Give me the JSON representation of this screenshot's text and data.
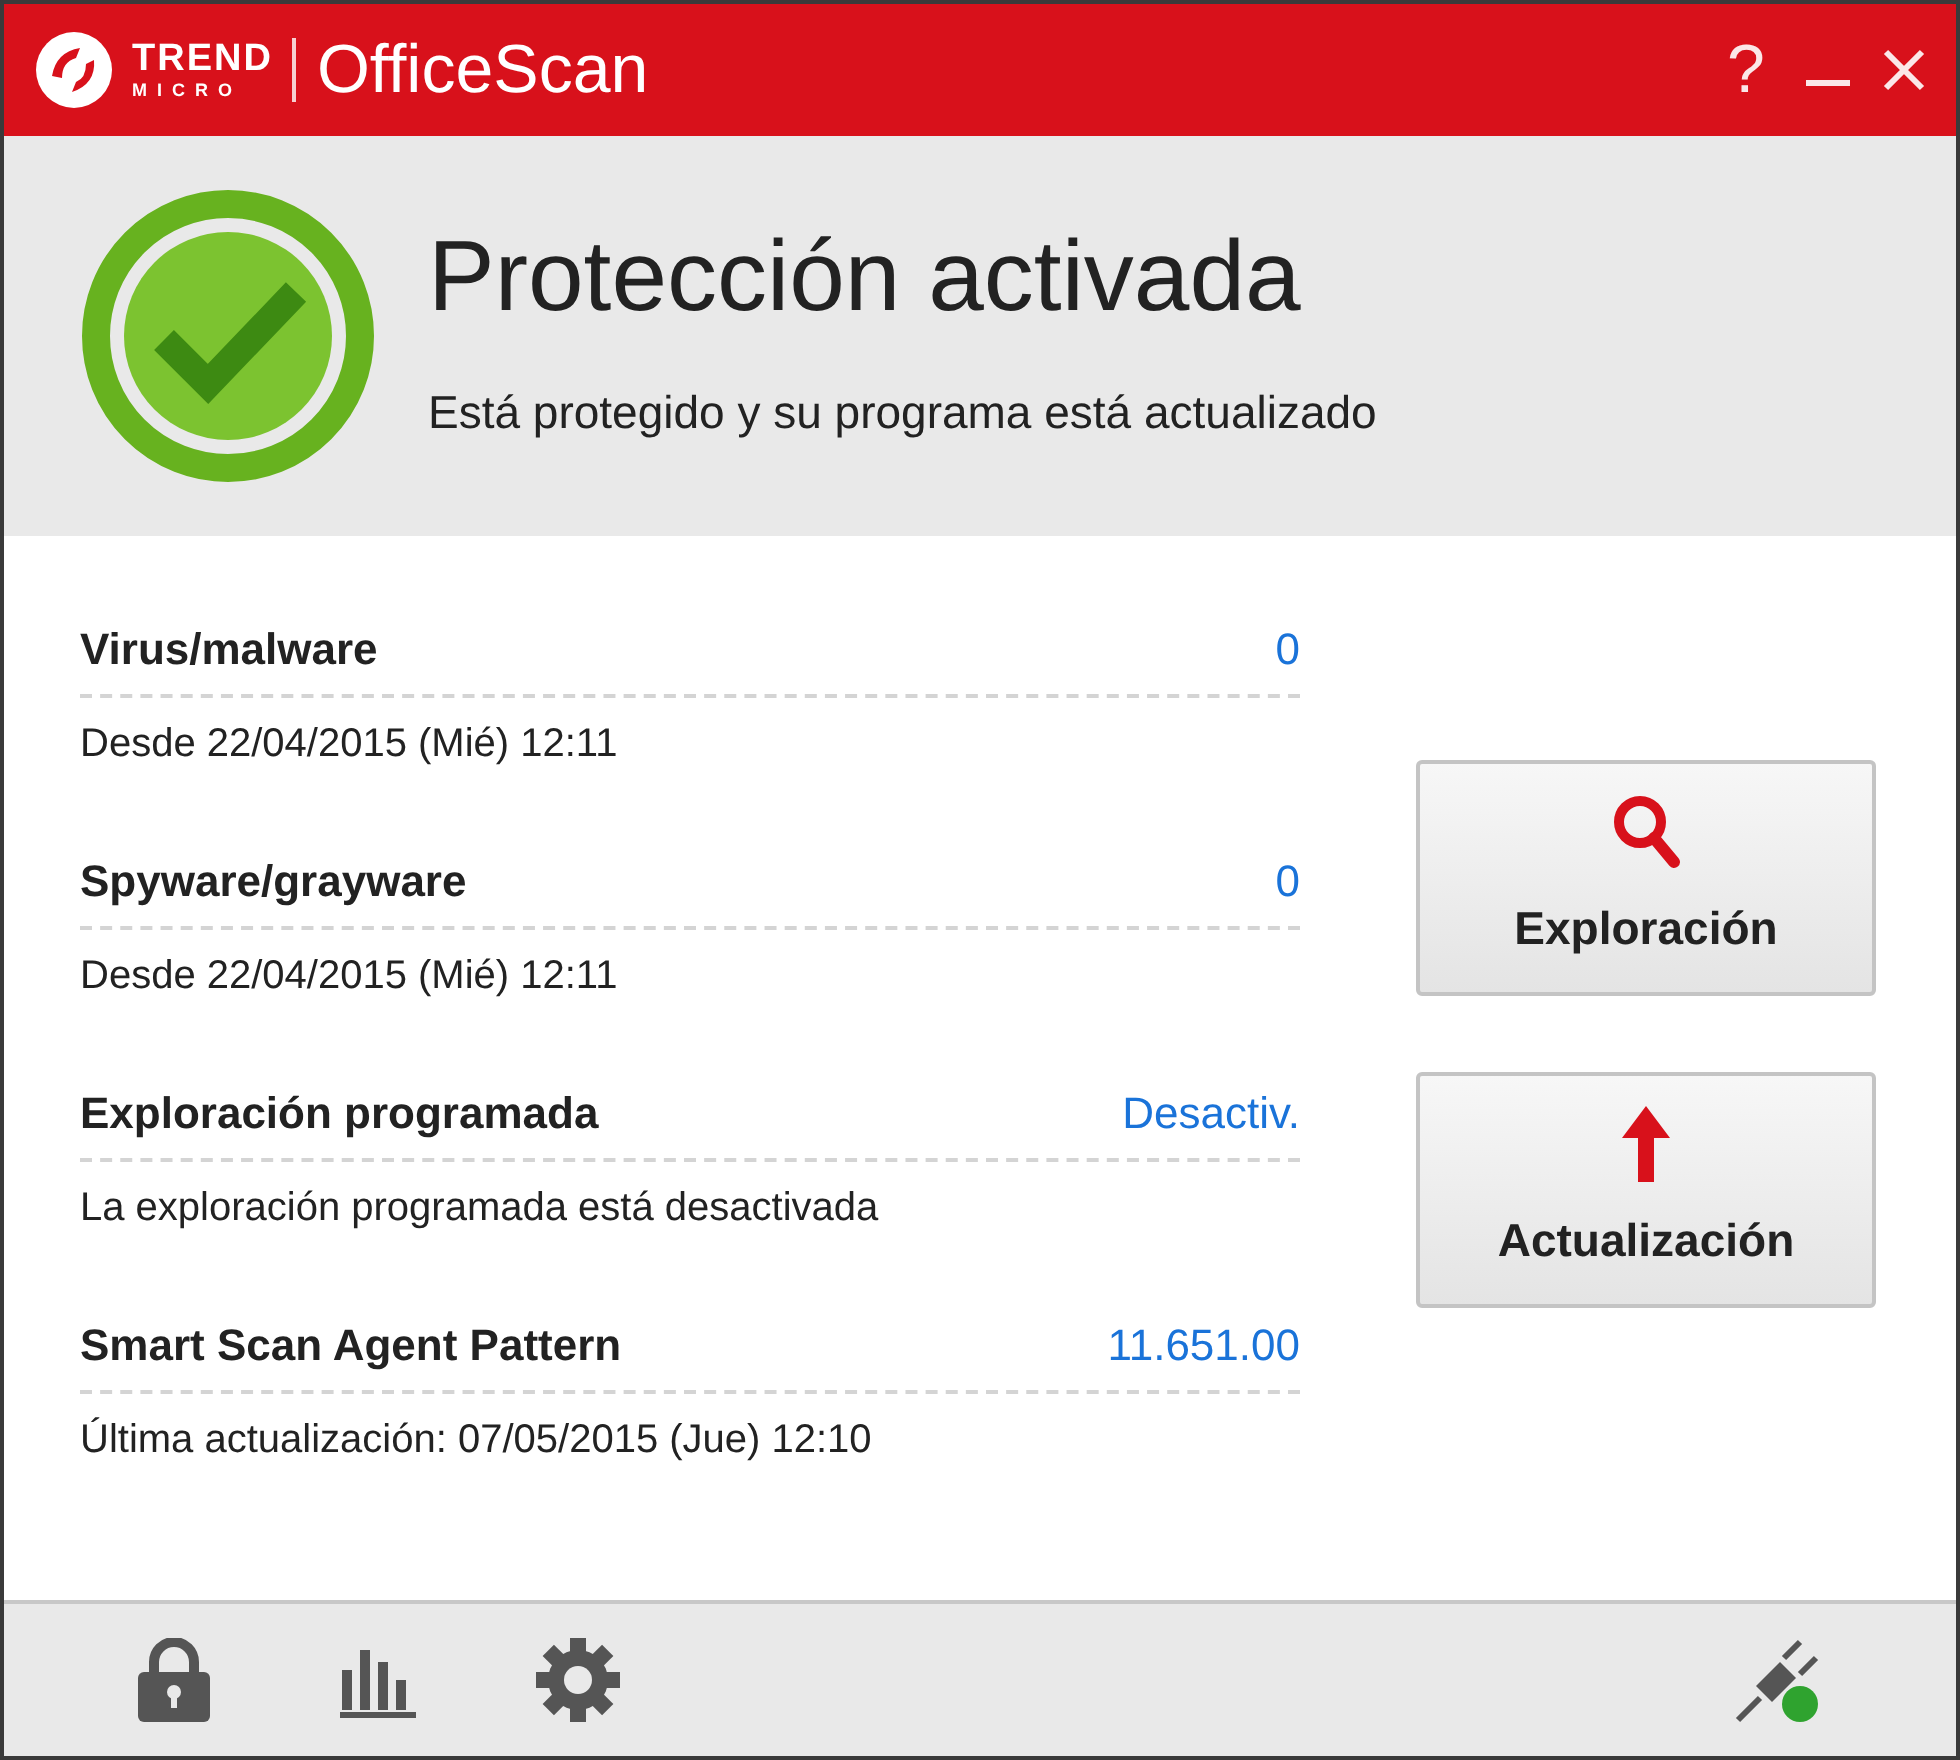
{
  "window": {
    "brand_top": "TREND",
    "brand_bottom": "MICRO",
    "title": "OfficeScan",
    "help": "?"
  },
  "status": {
    "heading": "Protección activada",
    "message": "Está protegido y su programa está actualizado"
  },
  "stats": [
    {
      "label": "Virus/malware",
      "value": "0",
      "detail": "Desde 22/04/2015 (Mié) 12:11"
    },
    {
      "label": "Spyware/grayware",
      "value": "0",
      "detail": "Desde 22/04/2015 (Mié) 12:11"
    },
    {
      "label": "Exploración programada",
      "value": "Desactiv.",
      "detail": "La exploración programada está desactivada"
    },
    {
      "label": "Smart Scan Agent Pattern",
      "value": "11.651.00",
      "detail": "Última actualización: 07/05/2015 (Jue) 12:10"
    }
  ],
  "buttons": [
    {
      "kind": "scan",
      "label": "Exploración"
    },
    {
      "kind": "update",
      "label": "Actualización"
    }
  ]
}
